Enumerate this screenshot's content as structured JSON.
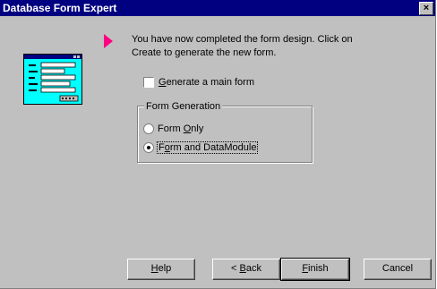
{
  "window": {
    "title": "Database Form Expert",
    "close_glyph": "×"
  },
  "instructions": "You have now completed the form design. Click on Create to generate the new form.",
  "options": {
    "generate_main_form": {
      "prefix": "",
      "accel": "G",
      "rest": "enerate a main form",
      "checked": false
    }
  },
  "form_generation": {
    "label": "Form Generation",
    "items": [
      {
        "prefix": "Form ",
        "accel": "O",
        "rest": "nly",
        "selected": false
      },
      {
        "prefix": "F",
        "accel": "o",
        "rest": "rm and DataModule",
        "selected": true
      }
    ]
  },
  "buttons": {
    "help": {
      "prefix": "",
      "accel": "H",
      "rest": "elp"
    },
    "back": {
      "prefix": "< ",
      "accel": "B",
      "rest": "ack"
    },
    "finish": {
      "prefix": "",
      "accel": "F",
      "rest": "inish"
    },
    "cancel": {
      "label": "Cancel"
    }
  },
  "colors": {
    "title_bar": "#000080",
    "pointer": "#ff0080",
    "dialog_face": "#c0c0c0",
    "illustration_bg": "#00ffff"
  },
  "icons": {
    "pointer": "pointer-arrow-icon",
    "illustration": "form-window-illustration"
  }
}
